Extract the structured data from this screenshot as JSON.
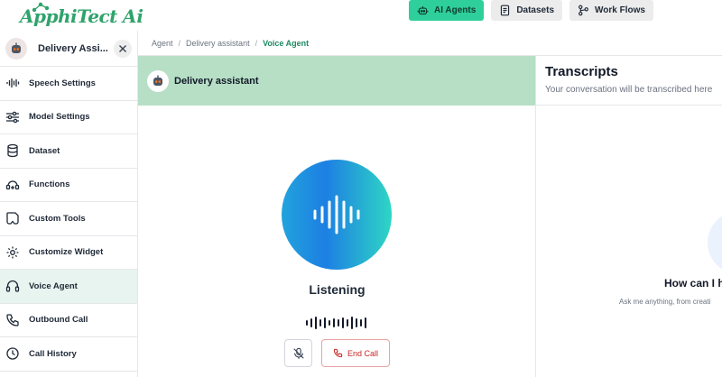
{
  "app": {
    "logo_text": "ApphiTect",
    "logo_suffix": "Ai"
  },
  "topnav": {
    "items": [
      {
        "label": "AI Agents",
        "icon": "robot-icon",
        "active": true
      },
      {
        "label": "Datasets",
        "icon": "document-icon",
        "active": false
      },
      {
        "label": "Work Flows",
        "icon": "workflow-icon",
        "active": false
      }
    ]
  },
  "sidebar": {
    "title": "Delivery Assi...",
    "items": [
      {
        "label": "Speech Settings",
        "icon": "waveform-icon"
      },
      {
        "label": "Model Settings",
        "icon": "sliders-icon"
      },
      {
        "label": "Dataset",
        "icon": "database-icon"
      },
      {
        "label": "Functions",
        "icon": "functions-icon"
      },
      {
        "label": "Custom Tools",
        "icon": "custom-tools-icon"
      },
      {
        "label": "Customize Widget",
        "icon": "gear-icon"
      },
      {
        "label": "Voice Agent",
        "icon": "headphones-icon",
        "active": true
      },
      {
        "label": "Outbound Call",
        "icon": "phone-icon"
      },
      {
        "label": "Call History",
        "icon": "history-icon"
      }
    ]
  },
  "breadcrumb": {
    "items": [
      "Agent",
      "Delivery assistant",
      "Voice Agent"
    ],
    "separator": "/"
  },
  "call": {
    "agent_name": "Delivery assistant",
    "status": "Listening",
    "end_label": "End Call"
  },
  "transcripts": {
    "title": "Transcripts",
    "subtitle": "Your conversation will be transcribed here",
    "prompt": "How can I h",
    "hint": "Ask me anything, from creati"
  },
  "colors": {
    "accent": "#2fcf9b",
    "header_green": "#b6dfc6",
    "active_item": "#e8f4ef",
    "brand": "#2ea36b",
    "danger": "#c62828"
  }
}
